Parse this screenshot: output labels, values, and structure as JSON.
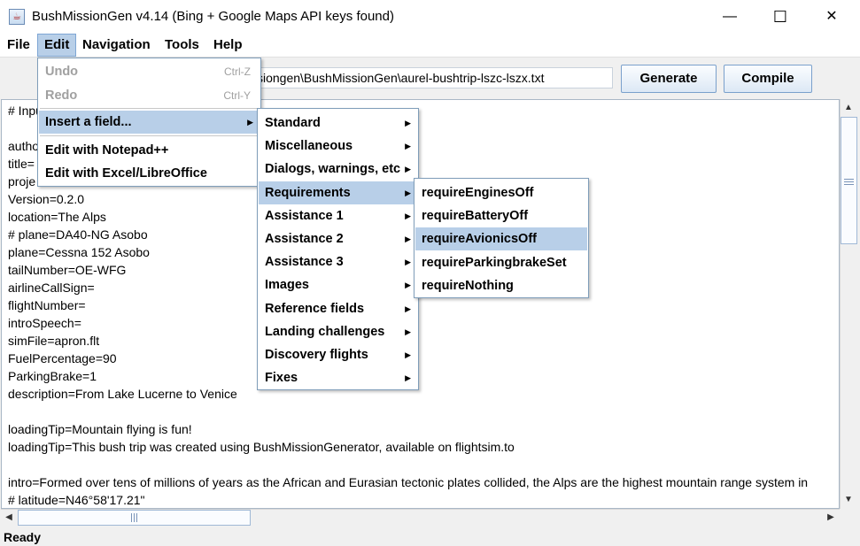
{
  "window": {
    "title": "BushMissionGen v4.14 (Bing + Google Maps API keys found)",
    "app_icon_glyph": "☕",
    "minimize_glyph": "—",
    "maximize_glyph": "☐",
    "close_glyph": "✕"
  },
  "menubar": {
    "file": "File",
    "edit": "Edit",
    "navigation": "Navigation",
    "tools": "Tools",
    "help": "Help"
  },
  "toolbar": {
    "path_value": "ssiongen\\BushMissionGen\\aurel-bushtrip-lszc-lszx.txt",
    "generate_label": "Generate",
    "compile_label": "Compile"
  },
  "editor": {
    "lines": [
      "# Inpu",
      "",
      "autho",
      "title=",
      "proje",
      "Version=0.2.0",
      "location=The Alps",
      "# plane=DA40-NG Asobo",
      "plane=Cessna 152 Asobo",
      "tailNumber=OE-WFG",
      "airlineCallSign=",
      "flightNumber=",
      "introSpeech=",
      "simFile=apron.flt",
      "FuelPercentage=90",
      "ParkingBrake=1",
      "description=From Lake Lucerne to Venice",
      "",
      "loadingTip=Mountain flying is fun!",
      "loadingTip=This bush trip was created using BushMissionGenerator, available on flightsim.to",
      "",
      "intro=Formed over tens of millions of years as the African and Eurasian tectonic plates collided, the Alps are the highest mountain range system in",
      "# latitude=N46°58'17.21\""
    ]
  },
  "edit_menu": {
    "undo": "Undo",
    "undo_shortcut": "Ctrl-Z",
    "redo": "Redo",
    "redo_shortcut": "Ctrl-Y",
    "insert_field": "Insert a field...",
    "edit_notepad": "Edit with Notepad++",
    "edit_excel": "Edit with Excel/LibreOffice"
  },
  "insert_submenu": {
    "items": [
      "Standard",
      "Miscellaneous",
      "Dialogs, warnings, etc",
      "Requirements",
      "Assistance 1",
      "Assistance 2",
      "Assistance 3",
      "Images",
      "Reference fields",
      "Landing challenges",
      "Discovery flights",
      "Fixes"
    ],
    "selected": "Requirements"
  },
  "requirements_submenu": {
    "items": [
      "requireEnginesOff",
      "requireBatteryOff",
      "requireAvionicsOff",
      "requireParkingbrakeSet",
      "requireNothing"
    ],
    "selected": "requireAvionicsOff"
  },
  "status": {
    "text": "Ready"
  },
  "colors": {
    "menu_highlight": "#b8cfe8",
    "menu_border": "#7f9db9",
    "disabled_text": "#a0a0a0"
  }
}
